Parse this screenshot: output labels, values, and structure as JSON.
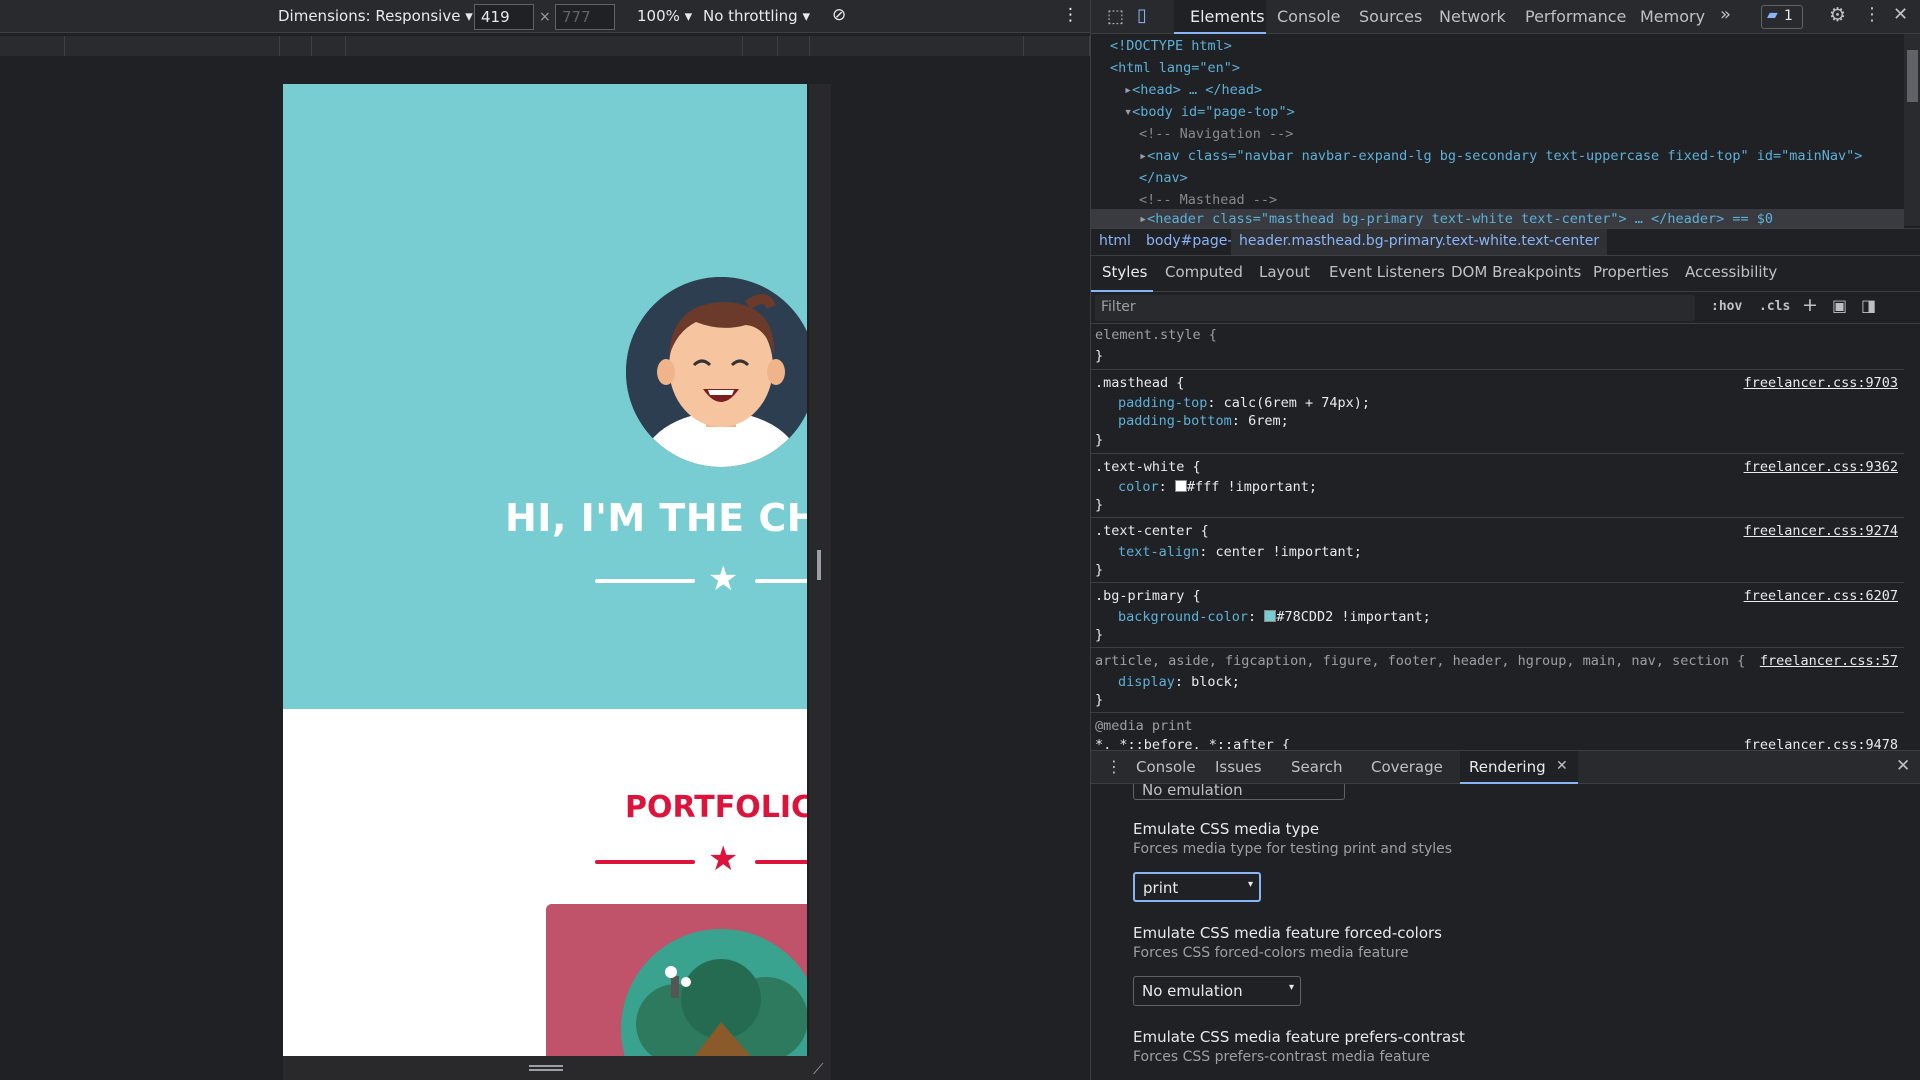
{
  "device_toolbar": {
    "dimensions_label": "Dimensions: Responsive",
    "width": "419",
    "height_placeholder": "777",
    "times": "×",
    "zoom": "100%",
    "throttling": "No throttling"
  },
  "viewport": {
    "hero_title": "HI, I'M THE CHE",
    "portfolio_title": "PORTFOLIC",
    "colors": {
      "primary": "#78CDD2",
      "secondary_accent": "#dc143c",
      "card": "#c0526a"
    }
  },
  "devtools": {
    "tabs": [
      "Elements",
      "Console",
      "Sources",
      "Network",
      "Performance",
      "Memory"
    ],
    "more_tabs": "»",
    "issues_count": "1",
    "dom_lines": [
      "<!DOCTYPE html>",
      "<html lang=\"en\">",
      "<head> … </head>",
      "<body id=\"page-top\">",
      "<!-- Navigation -->",
      "<nav class=\"navbar navbar-expand-lg bg-secondary text-uppercase fixed-top\" id=\"mainNav\">",
      "</nav>",
      "<!-- Masthead -->",
      "<header class=\"masthead bg-primary text-white text-center\"> … </header> == $0"
    ],
    "breadcrumbs": [
      "html",
      "body#page-top",
      "header.masthead.bg-primary.text-white.text-center"
    ],
    "style_tabs": [
      "Styles",
      "Computed",
      "Layout",
      "Event Listeners",
      "DOM Breakpoints",
      "Properties",
      "Accessibility"
    ],
    "filter_placeholder": "Filter",
    "hov": ":hov",
    "cls": ".cls",
    "rules": [
      {
        "selector": "element.style {",
        "props": [],
        "source": ""
      },
      {
        "selector": ".masthead {",
        "props": [
          [
            "padding-top",
            "calc(6rem + 74px);"
          ],
          [
            "padding-bottom",
            "6rem;"
          ]
        ],
        "source": "freelancer.css:9703"
      },
      {
        "selector": ".text-white {",
        "props": [
          [
            "color",
            "#fff !important;"
          ]
        ],
        "source": "freelancer.css:9362"
      },
      {
        "selector": ".text-center {",
        "props": [
          [
            "text-align",
            "center !important;"
          ]
        ],
        "source": "freelancer.css:9274"
      },
      {
        "selector": ".bg-primary {",
        "props": [
          [
            "background-color",
            "#78CDD2 !important;"
          ]
        ],
        "source": "freelancer.css:6207"
      },
      {
        "selector": "article, aside, figcaption, figure, footer, header, hgroup, main, nav, section {",
        "props": [
          [
            "display",
            "block;"
          ]
        ],
        "source": "freelancer.css:57"
      },
      {
        "selector": "@media print",
        "props": [],
        "source": ""
      },
      {
        "selector": "*, *::before, *::after {",
        "props": [],
        "source": "freelancer.css:9478"
      }
    ],
    "drawer_tabs": [
      "Console",
      "Issues",
      "Search",
      "Coverage",
      "Rendering"
    ],
    "rendering": {
      "cut_select": "No emulation",
      "media_type_title": "Emulate CSS media type",
      "media_type_sub": "Forces media type for testing print and styles",
      "media_type_value": "print",
      "forced_colors_title": "Emulate CSS media feature forced-colors",
      "forced_colors_sub": "Forces CSS forced-colors media feature",
      "forced_colors_value": "No emulation",
      "prefers_contrast_title": "Emulate CSS media feature prefers-contrast",
      "prefers_contrast_sub": "Forces CSS prefers-contrast media feature"
    }
  }
}
